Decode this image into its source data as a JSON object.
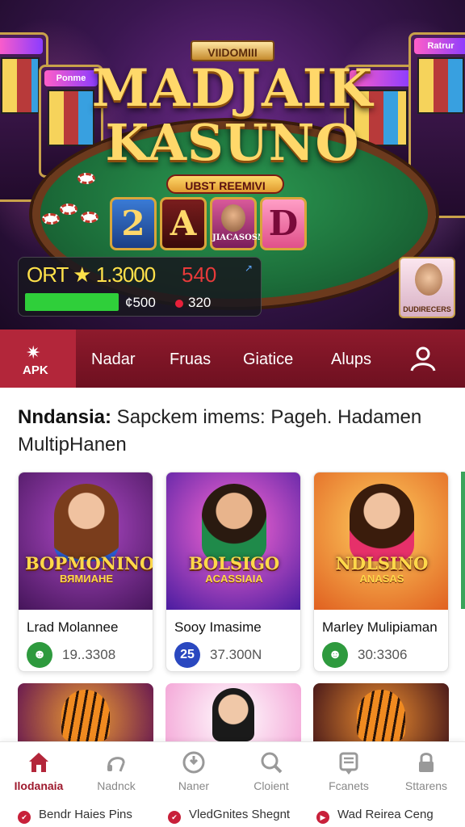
{
  "hero": {
    "sign": "VIIDOMIII",
    "title_line1": "MADJAIK",
    "title_line2": "KASUNO",
    "ribbon": "UBST REEMIVI",
    "slot_sign_left": "Ponme",
    "slot_sign_right": "Ratrur",
    "reels": [
      "2",
      "A",
      "JIACASOSNE",
      "D"
    ],
    "stats": {
      "score": "ORT ★ 1.3000",
      "red_value": "540",
      "arrow": "↗",
      "balance_a": "¢500",
      "balance_b": "320"
    },
    "promo_card_caption": "DUDIRECERS"
  },
  "nav": {
    "apk_label": "APK",
    "items": [
      "Nadar",
      "Fruas",
      "Giatice",
      "Alups"
    ]
  },
  "headline": {
    "bold": "Nndansia:",
    "rest": " Sapckem imems: Pageh. Hadamen MultipHanen"
  },
  "cards": [
    {
      "banner": "BOPMONINO",
      "banner2": "ВЯМИАНЕ",
      "name": "Lrad Molannee",
      "badge": "☻",
      "count": "19..3308"
    },
    {
      "banner": "BOLSIGO",
      "banner2": "ACASSIAIA",
      "name": "Sooy Imasime",
      "badge": "25",
      "count": "37.300N"
    },
    {
      "banner": "NDLSINO",
      "banner2": "ANASAS",
      "name": "Marley Mulipiaman",
      "badge": "☻",
      "count": "30:3306"
    }
  ],
  "tabs": [
    {
      "label": "Ilodanaia",
      "icon": "home-icon",
      "active": true
    },
    {
      "label": "Nadnck",
      "icon": "headset-icon",
      "active": false
    },
    {
      "label": "Naner",
      "icon": "power-icon",
      "active": false
    },
    {
      "label": "Cloient",
      "icon": "search-icon",
      "active": false
    },
    {
      "label": "Fcanets",
      "icon": "document-icon",
      "active": false
    },
    {
      "label": "Sttarens",
      "icon": "lock-icon",
      "active": false
    }
  ],
  "footer": [
    "Bendr Haies Pins",
    "VledGnites Shegnt",
    "Wad Reirea Ceng"
  ],
  "colors": {
    "brand": "#8e1a2c",
    "accent_gold": "#ffd86a",
    "active_tab": "#9e1a2e",
    "progress": "#2fcf3a"
  }
}
